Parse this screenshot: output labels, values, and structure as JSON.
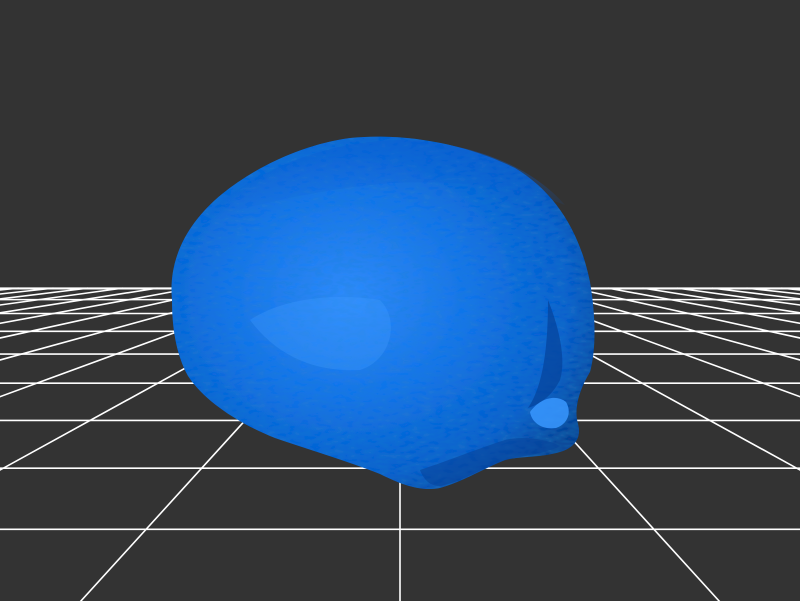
{
  "viewer": {
    "background_color": "#333333",
    "grid_color": "#ffffff",
    "mesh_color": "#0a64d8",
    "mesh_highlight_color": "#2e8bff",
    "mesh_shadow_color": "#063f96",
    "grid": "on",
    "object": "3d-mesh"
  }
}
